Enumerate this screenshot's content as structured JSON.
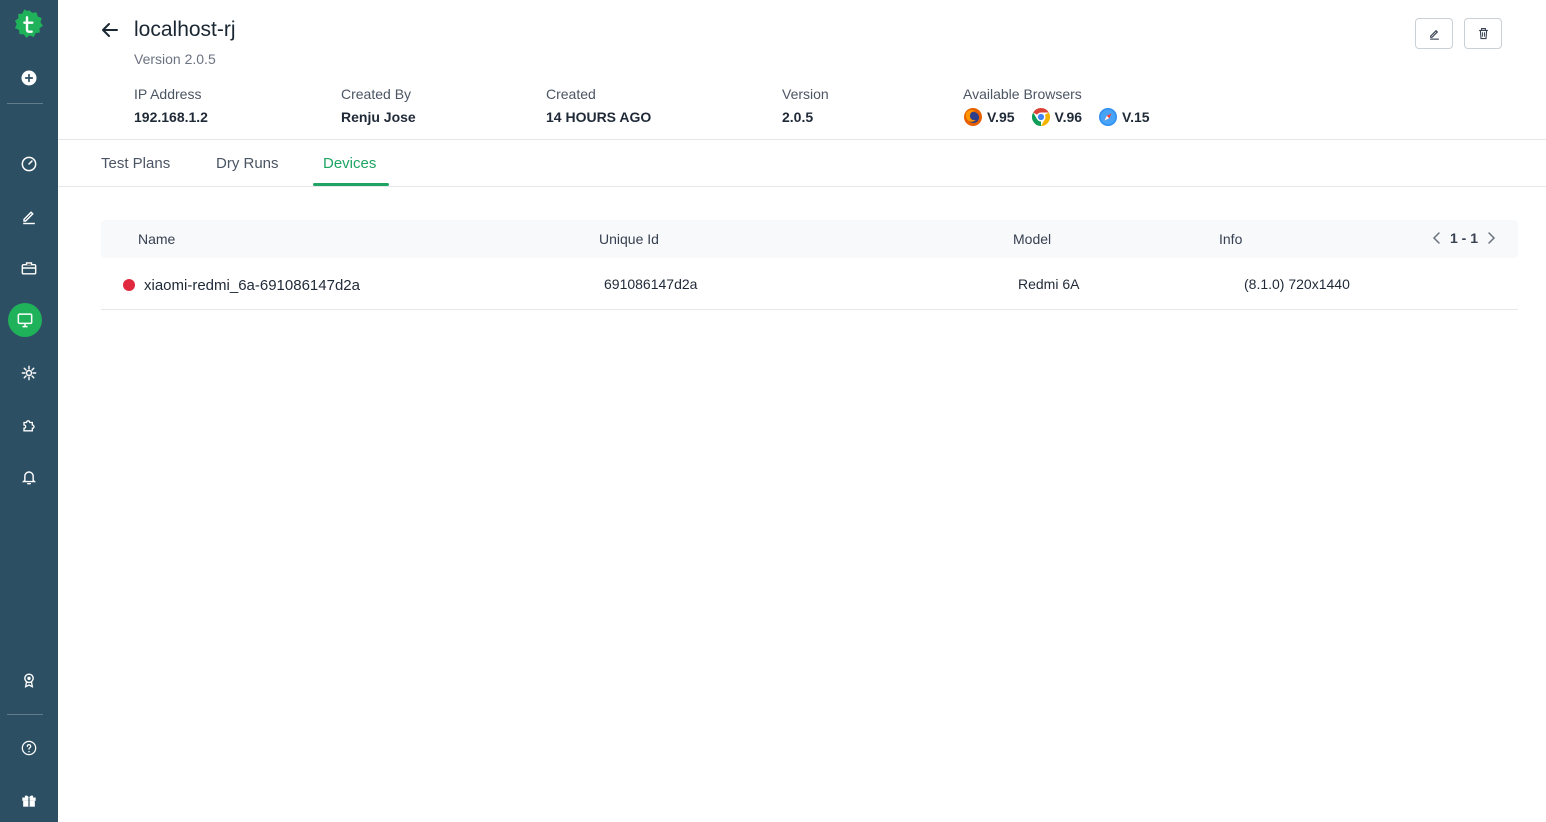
{
  "header": {
    "title": "localhost-rj",
    "subtitle": "Version 2.0.5"
  },
  "meta": {
    "ip": {
      "label": "IP Address",
      "value": "192.168.1.2"
    },
    "created_by": {
      "label": "Created By",
      "value": "Renju Jose"
    },
    "created": {
      "label": "Created",
      "value": "14 HOURS AGO"
    },
    "version": {
      "label": "Version",
      "value": "2.0.5"
    },
    "browsers": {
      "label": "Available Browsers",
      "items": [
        {
          "icon": "firefox-icon",
          "version": "V.95"
        },
        {
          "icon": "chrome-icon",
          "version": "V.96"
        },
        {
          "icon": "safari-icon",
          "version": "V.15"
        }
      ]
    }
  },
  "tabs": [
    {
      "label": "Test Plans"
    },
    {
      "label": "Dry Runs"
    },
    {
      "label": "Devices",
      "active": true
    }
  ],
  "table": {
    "columns": [
      "Name",
      "Unique Id",
      "Model",
      "Info"
    ],
    "pager": "1 - 1",
    "rows": [
      {
        "status": "offline",
        "name": "xiaomi-redmi_6a-691086147d2a",
        "unique_id": "691086147d2a",
        "model": "Redmi 6A",
        "info": "(8.1.0) 720x1440"
      }
    ]
  },
  "colors": {
    "sidebar": "#2d4f63",
    "accent": "#1fa463",
    "status_offline": "#e0293f"
  },
  "sidebar_icons": [
    "logo-icon",
    "add-icon",
    "dashboard-icon",
    "edit-icon",
    "briefcase-icon",
    "monitor-icon",
    "settings-icon",
    "plugin-icon",
    "bell-icon",
    "badge-icon",
    "help-icon",
    "gift-icon"
  ]
}
